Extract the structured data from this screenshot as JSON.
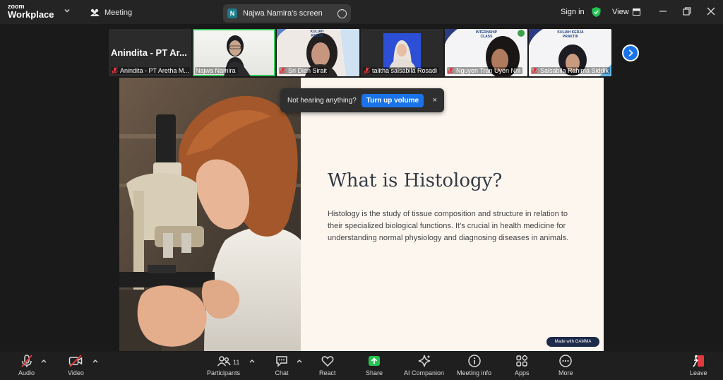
{
  "app": {
    "logo_top": "zoom",
    "logo_bottom": "Workplace"
  },
  "titlebar": {
    "meeting_label": "Meeting",
    "screen_tab_badge": "N",
    "screen_tab_label": "Najwa Namira's screen",
    "sign_in": "Sign in",
    "view_label": "View"
  },
  "participants": [
    {
      "big_name": "Anindita - PT Ar...",
      "label": "Anindita - PT Aretha M...",
      "muted": true,
      "active": false
    },
    {
      "label": "Najwa Namira",
      "muted": false,
      "active": true
    },
    {
      "label": "Sri Dian Sirait",
      "muted": true,
      "active": false,
      "slide_text": "KULIAH KERJA"
    },
    {
      "label": "talitha salsabila Rosadi",
      "muted": true,
      "active": false
    },
    {
      "label": "Nguyen Tran Uyen Nhi",
      "muted": true,
      "active": false,
      "slide_text": "INTERNSHIP CLASS"
    },
    {
      "label": "Salsabila Rahima Siddik",
      "muted": true,
      "active": false,
      "slide_text": "KULIAH KERJA PRAKTIK"
    }
  ],
  "slide": {
    "title": "What is Histology?",
    "body": "Histology is the study of tissue composition and structure in relation to their specialized biological functions. It's crucial in health medicine for understanding normal physiology and diagnosing diseases in animals.",
    "made_with": "Made with GAMMA"
  },
  "toast": {
    "message": "Not hearing anything?",
    "button": "Turn up volume",
    "close": "×"
  },
  "toolbar": {
    "audio": "Audio",
    "video": "Video",
    "participants": "Participants",
    "participants_count": "11",
    "chat": "Chat",
    "react": "React",
    "share": "Share",
    "ai_companion": "AI Companion",
    "meeting_info": "Meeting info",
    "apps": "Apps",
    "more": "More",
    "leave": "Leave"
  },
  "colors": {
    "accent_blue": "#1a73e8",
    "active_green": "#34c759",
    "share_green": "#23c552",
    "mute_red": "#e0393e",
    "slide_bg": "#fdf6ef"
  }
}
